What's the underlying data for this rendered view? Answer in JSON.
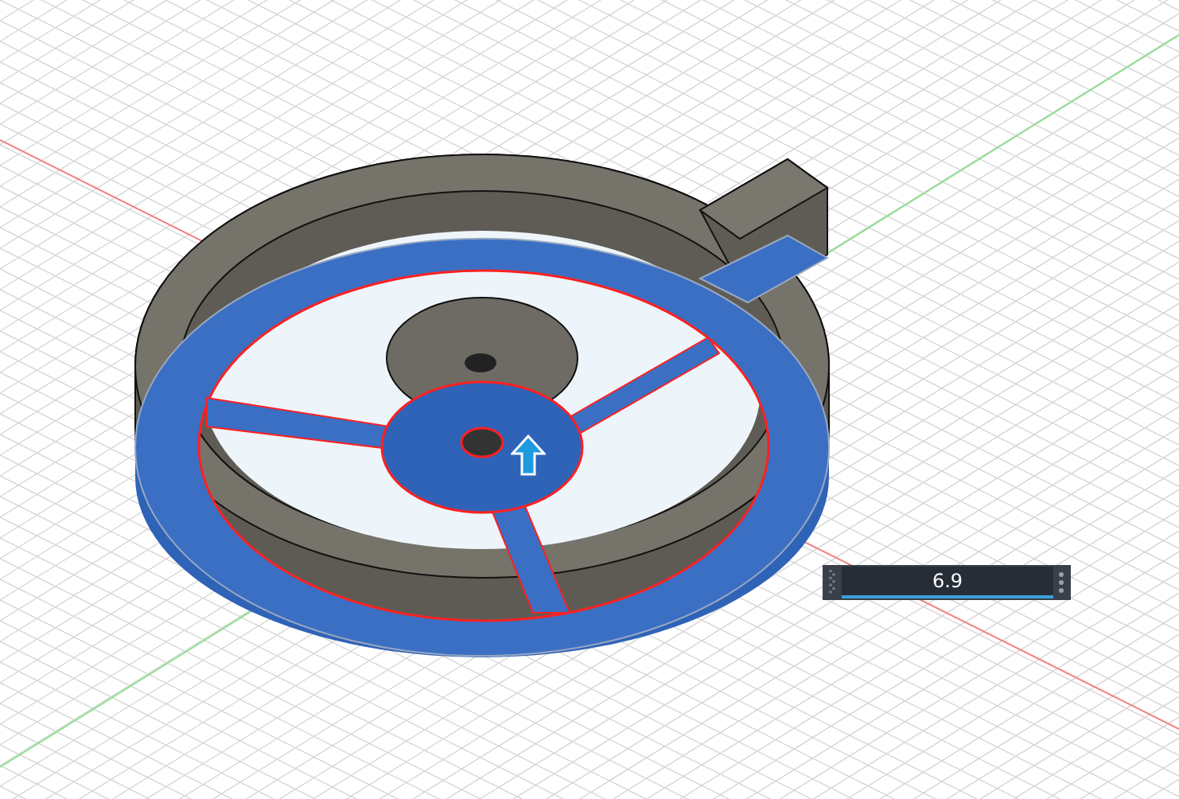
{
  "dimension_input": {
    "value": "6.9"
  }
}
